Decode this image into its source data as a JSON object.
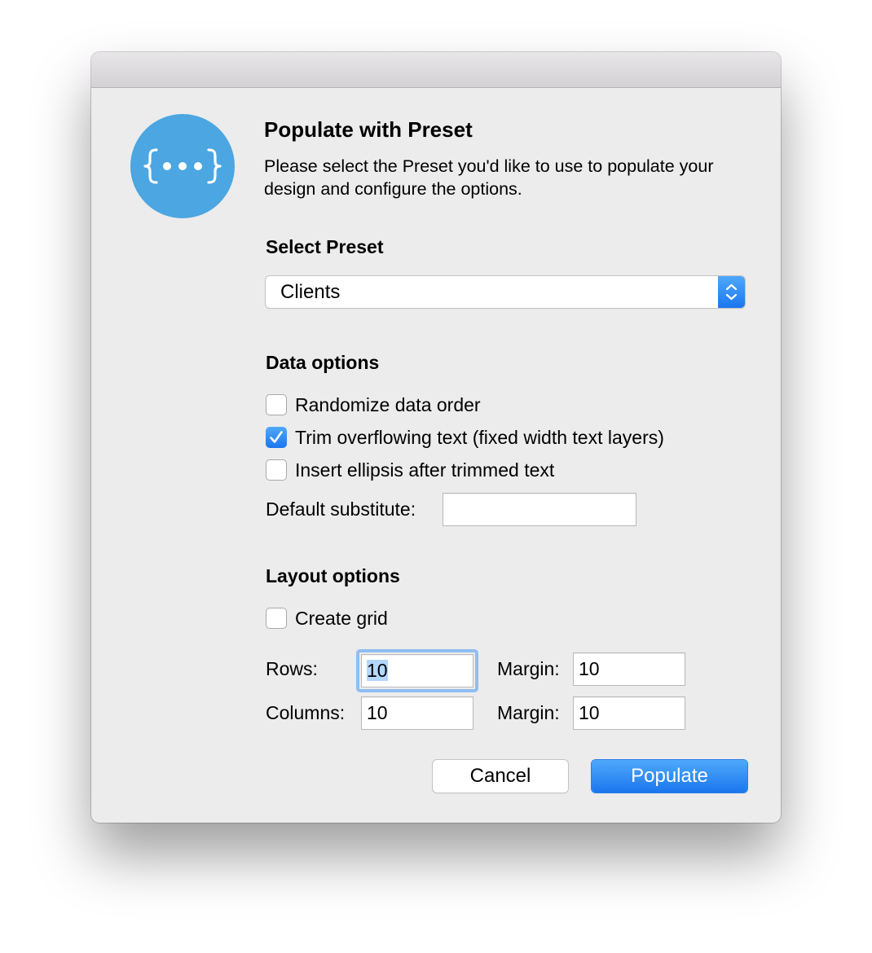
{
  "colors": {
    "accent": "#1b76ee",
    "icon_background": "#4ba6e1",
    "window_background": "#ececec",
    "focus_ring": "#8ebef3"
  },
  "dialog": {
    "icon": "curly-braces-ellipsis-icon",
    "title": "Populate with Preset",
    "description": "Please select the Preset you'd like to use to populate your design and configure the options."
  },
  "preset": {
    "section_title": "Select Preset",
    "selected": "Clients",
    "stepper_icon": "chevron-up-down-icon"
  },
  "data_options": {
    "section_title": "Data options",
    "checkboxes": [
      {
        "label": "Randomize data order",
        "checked": false
      },
      {
        "label": "Trim overflowing text (fixed width text layers)",
        "checked": true
      },
      {
        "label": "Insert ellipsis after trimmed text",
        "checked": false
      }
    ],
    "default_substitute_label": "Default substitute:",
    "default_substitute_value": ""
  },
  "layout_options": {
    "section_title": "Layout options",
    "create_grid_label": "Create grid",
    "create_grid_checked": false,
    "rows_label": "Rows:",
    "rows_value": "10",
    "rows_margin_label": "Margin:",
    "rows_margin_value": "10",
    "columns_label": "Columns:",
    "columns_value": "10",
    "columns_margin_label": "Margin:",
    "columns_margin_value": "10"
  },
  "buttons": {
    "cancel": "Cancel",
    "populate": "Populate"
  }
}
